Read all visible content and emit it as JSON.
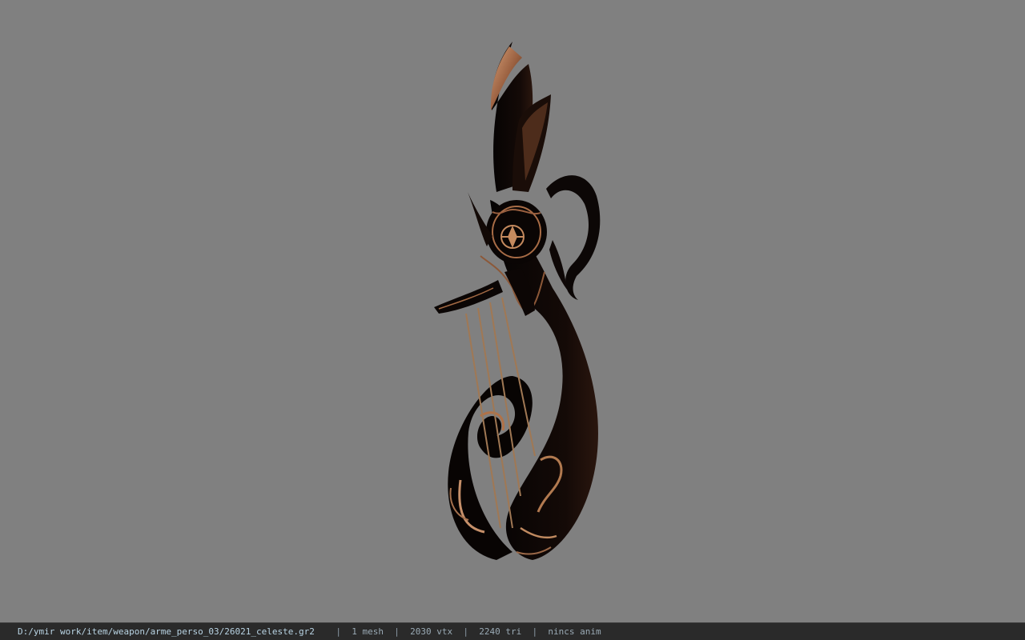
{
  "viewer": {
    "background_color": "#808080",
    "model": {
      "icon": "harp-weapon-model",
      "primary_color": "#0a0605",
      "accent_color": "#b87a4e"
    }
  },
  "statusbar": {
    "file_path": "D:/ymir work/item/weapon/arme_perso_03/26021_celeste.gr2",
    "separator": "|",
    "mesh_count": "1 mesh",
    "vertex_count": "2030 vtx",
    "triangle_count": "2240 tri",
    "animation": "nincs anim"
  }
}
